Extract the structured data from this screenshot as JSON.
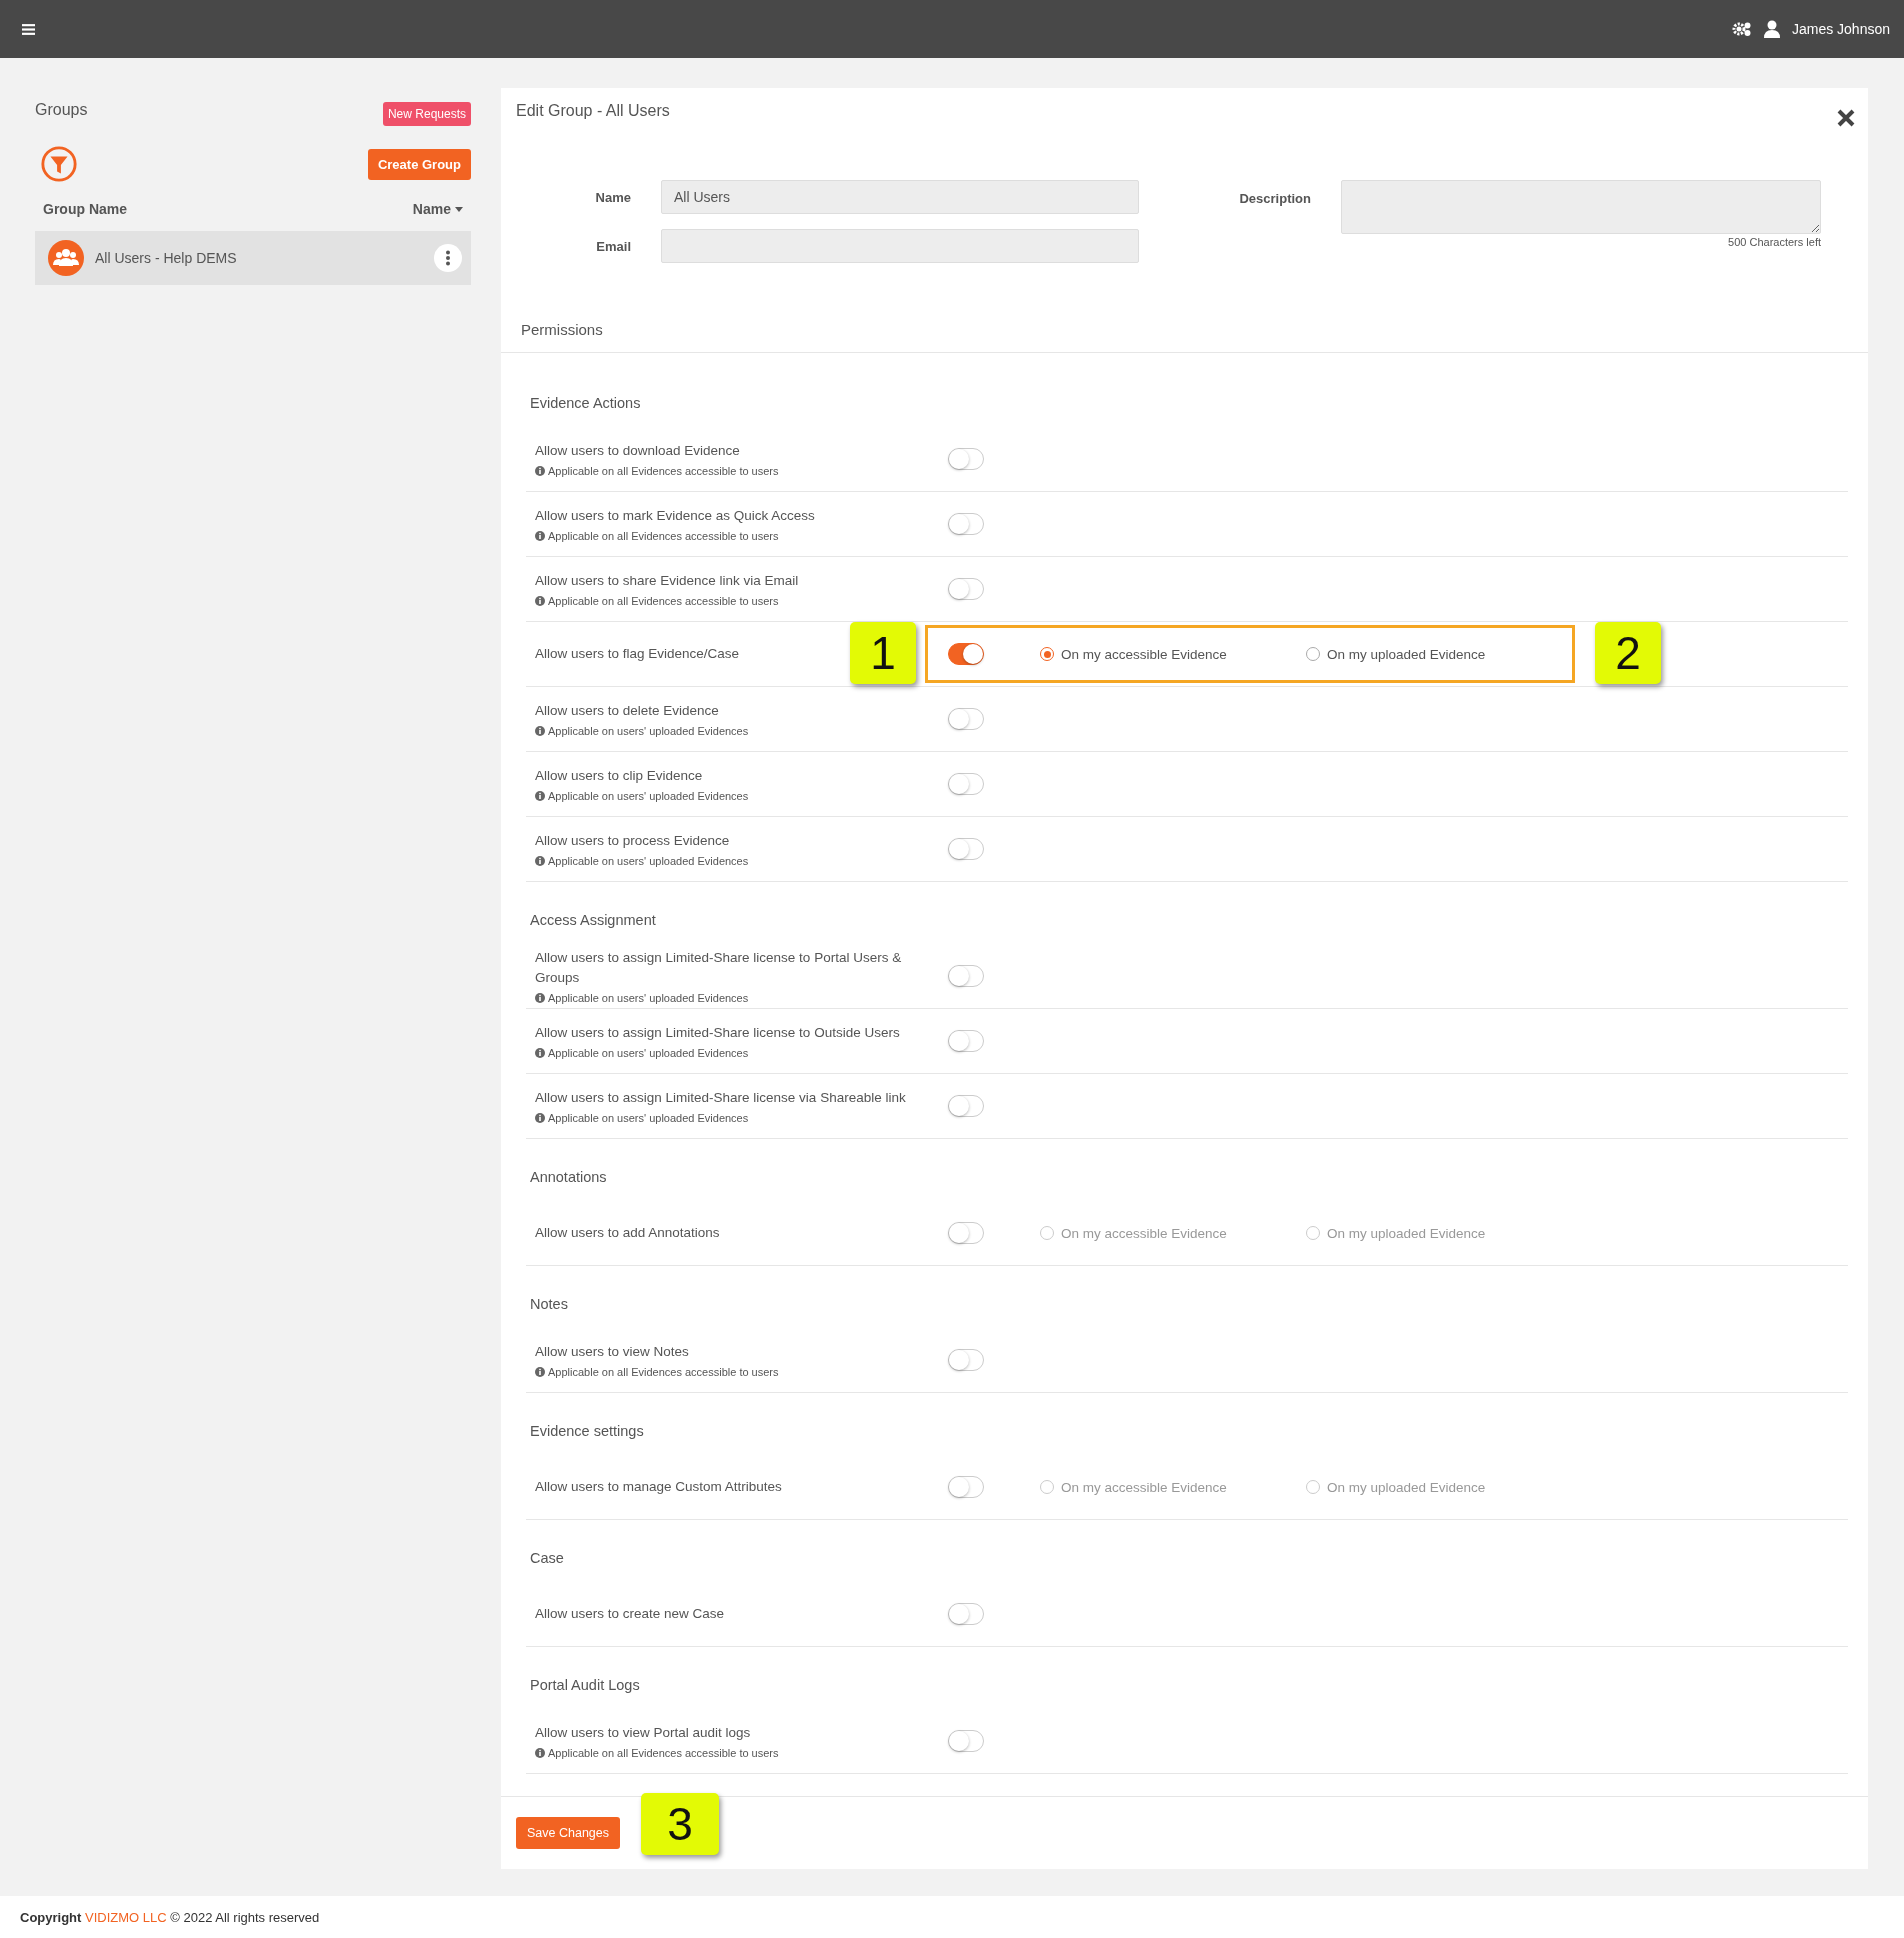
{
  "top_bar": {
    "user_name": "James Johnson"
  },
  "groups_panel": {
    "title": "Groups",
    "new_requests_button": "New Requests",
    "create_group_button": "Create Group",
    "column_header": "Group Name",
    "sort_label": "Name",
    "rows": [
      {
        "name": "All Users - Help DEMS",
        "selected": true
      }
    ]
  },
  "edit_panel": {
    "title": "Edit Group - All Users",
    "fields": {
      "name_label": "Name",
      "name_value": "All Users",
      "email_label": "Email",
      "description_label": "Description",
      "characters_left": "500 Characters left"
    },
    "permissions_title": "Permissions",
    "sections": [
      {
        "title": "Evidence Actions",
        "items": [
          {
            "label": "Allow users to download Evidence",
            "note": "Applicable on all Evidences accessible to users",
            "on": false
          },
          {
            "label": "Allow users to mark Evidence as Quick Access",
            "note": "Applicable on all Evidences accessible to users",
            "on": false
          },
          {
            "label": "Allow users to share Evidence link via Email",
            "note": "Applicable on all Evidences accessible to users",
            "on": false
          },
          {
            "label": "Allow users to flag Evidence/Case",
            "on": true,
            "highlighted": true,
            "callouts": [
              "1",
              "2"
            ],
            "options": [
              {
                "label": "On my accessible Evidence",
                "selected": true
              },
              {
                "label": "On my uploaded Evidence",
                "selected": false
              }
            ]
          },
          {
            "label": "Allow users to delete Evidence",
            "note": "Applicable on users' uploaded Evidences",
            "on": false
          },
          {
            "label": "Allow users to clip Evidence",
            "note": "Applicable on users' uploaded Evidences",
            "on": false
          },
          {
            "label": "Allow users to process Evidence",
            "note": "Applicable on users' uploaded Evidences",
            "on": false
          }
        ]
      },
      {
        "title": "Access Assignment",
        "items": [
          {
            "label": "Allow users to assign Limited-Share license to Portal Users & Groups",
            "note": "Applicable on users' uploaded Evidences",
            "on": false
          },
          {
            "label": "Allow users to assign Limited-Share license to Outside Users",
            "note": "Applicable on users' uploaded Evidences",
            "on": false
          },
          {
            "label": "Allow users to assign Limited-Share license via Shareable link",
            "note": "Applicable on users' uploaded Evidences",
            "on": false
          }
        ]
      },
      {
        "title": "Annotations",
        "items": [
          {
            "label": "Allow users to add Annotations",
            "on": false,
            "options": [
              {
                "label": "On my accessible Evidence",
                "selected": false
              },
              {
                "label": "On my uploaded Evidence",
                "selected": false
              }
            ]
          }
        ]
      },
      {
        "title": "Notes",
        "items": [
          {
            "label": "Allow users to view Notes",
            "note": "Applicable on all Evidences accessible to users",
            "on": false
          }
        ]
      },
      {
        "title": "Evidence settings",
        "items": [
          {
            "label": "Allow users to manage Custom Attributes",
            "on": false,
            "options": [
              {
                "label": "On my accessible Evidence",
                "selected": false
              },
              {
                "label": "On my uploaded Evidence",
                "selected": false
              }
            ]
          }
        ]
      },
      {
        "title": "Case",
        "items": [
          {
            "label": "Allow users to create new Case",
            "on": false
          }
        ]
      },
      {
        "title": "Portal Audit Logs",
        "items": [
          {
            "label": "Allow users to view Portal audit logs",
            "note": "Applicable on all Evidences accessible to users",
            "on": false
          }
        ]
      }
    ],
    "save_button": "Save Changes",
    "save_callout": "3"
  },
  "footer": {
    "copyright_label": "Copyright",
    "company_link": "VIDIZMO LLC",
    "rights": "© 2022 All rights reserved"
  }
}
